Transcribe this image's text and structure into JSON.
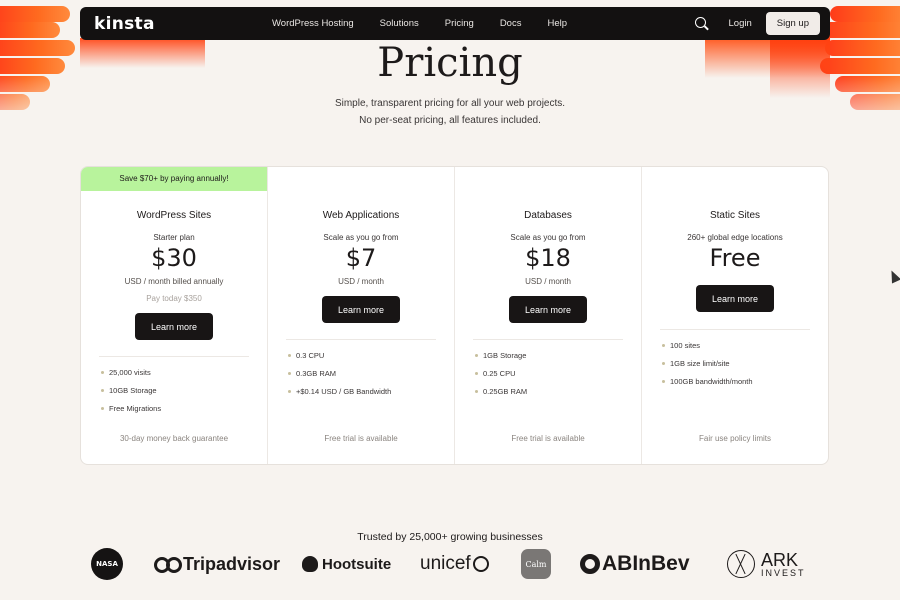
{
  "nav": {
    "logo": "kinsta",
    "links": [
      "WordPress Hosting",
      "Solutions",
      "Pricing",
      "Docs",
      "Help"
    ],
    "login": "Login",
    "signup": "Sign up"
  },
  "hero": {
    "title": "Pricing",
    "subtitle1": "Simple, transparent pricing for all your web projects.",
    "subtitle2": "No per-seat pricing, all features included."
  },
  "plans": [
    {
      "promo": "Save $70+ by paying annually!",
      "name": "WordPress Sites",
      "label": "Starter plan",
      "price": "$30",
      "unit": "USD  / month billed annually",
      "payday": "Pay today $350",
      "cta": "Learn more",
      "features": [
        "25,000 visits",
        "10GB Storage",
        "Free Migrations"
      ],
      "footer": "30-day money back guarantee"
    },
    {
      "name": "Web Applications",
      "label": "Scale as you go from",
      "price": "$7",
      "unit": "USD  / month",
      "cta": "Learn more",
      "features": [
        "0.3 CPU",
        "0.3GB RAM",
        "+$0.14 USD / GB Bandwidth"
      ],
      "footer": "Free trial is available"
    },
    {
      "name": "Databases",
      "label": "Scale as you go from",
      "price": "$18",
      "unit": "USD  / month",
      "cta": "Learn more",
      "features": [
        "1GB Storage",
        "0.25 CPU",
        "0.25GB RAM"
      ],
      "footer": "Free trial is available"
    },
    {
      "name": "Static Sites",
      "label": "260+ global edge locations",
      "price": "Free",
      "cta": "Learn more",
      "features": [
        "100 sites",
        "1GB size limit/site",
        "100GB bandwidth/month"
      ],
      "footer": "Fair use policy limits"
    }
  ],
  "trusted": {
    "heading": "Trusted by 25,000+ growing businesses",
    "logos": {
      "nasa": "NASA",
      "tripadvisor": "Tripadvisor",
      "hootsuite": "Hootsuite",
      "unicef": "unicef",
      "calm": "Calm",
      "abinbev": "ABInBev",
      "ark_top": "ARK",
      "ark_bottom": "INVEST"
    }
  },
  "colors": {
    "accent": "#ff4a1c",
    "promo_bg": "#b8f39c",
    "nav_bg": "#131111",
    "page_bg": "#f7f3ef"
  }
}
